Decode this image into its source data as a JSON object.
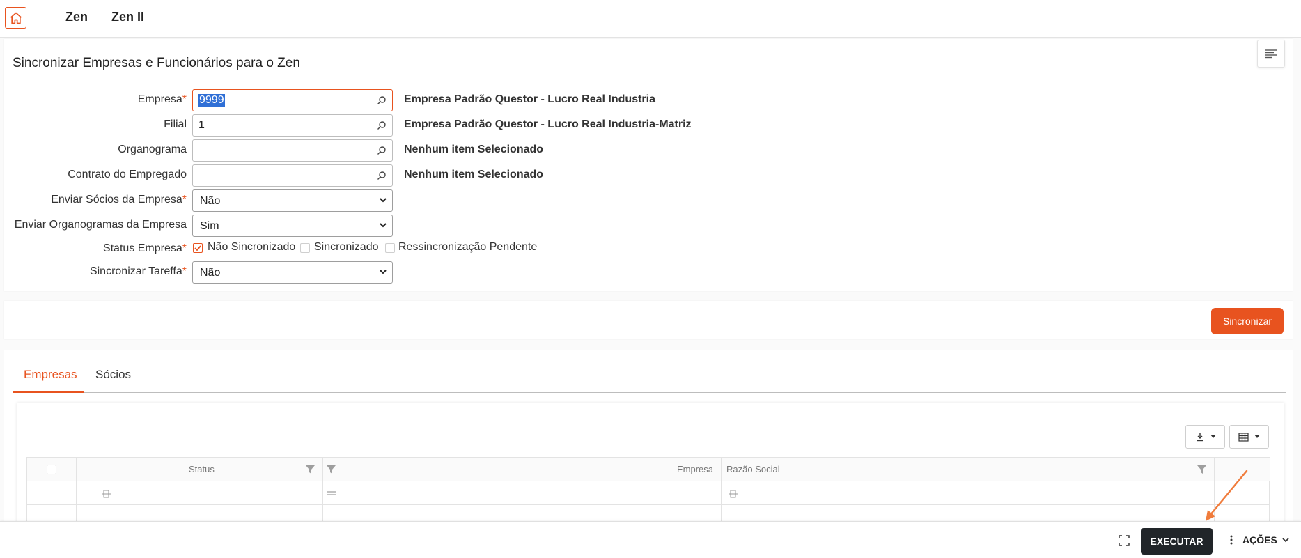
{
  "nav": {
    "links": [
      "Zen",
      "Zen II"
    ]
  },
  "panel": {
    "title": "Sincronizar Empresas e Funcionários para o Zen"
  },
  "form": {
    "empresa": {
      "label": "Empresa",
      "value": "9999",
      "desc": "Empresa Padrão Questor - Lucro Real Industria"
    },
    "filial": {
      "label": "Filial",
      "value": "1",
      "desc": "Empresa Padrão Questor - Lucro Real Industria-Matriz"
    },
    "organograma": {
      "label": "Organograma",
      "value": "",
      "desc": "Nenhum item Selecionado"
    },
    "contrato": {
      "label": "Contrato do Empregado",
      "value": "",
      "desc": "Nenhum item Selecionado"
    },
    "enviar_socios": {
      "label": "Enviar Sócios da Empresa",
      "value": "Não"
    },
    "enviar_organogramas": {
      "label": "Enviar Organogramas da Empresa",
      "value": "Sim"
    },
    "status_empresa": {
      "label": "Status Empresa",
      "options": [
        {
          "label": "Não Sincronizado",
          "checked": true
        },
        {
          "label": "Sincronizado",
          "checked": false
        },
        {
          "label": "Ressincronização Pendente",
          "checked": false
        }
      ]
    },
    "sincronizar_tareffa": {
      "label": "Sincronizar Tareffa",
      "value": "Não"
    },
    "required_mark": "*"
  },
  "actions": {
    "sync_label": "Sincronizar"
  },
  "tabs": [
    "Empresas",
    "Sócios"
  ],
  "grid": {
    "columns": [
      "Status",
      "Empresa",
      "Razão Social"
    ]
  },
  "bottom": {
    "execute_label": "EXECUTAR",
    "actions_label": "AÇÕES"
  },
  "colors": {
    "accent": "#e8531f",
    "dark_button": "#212529",
    "selection": "#2f6fd6"
  }
}
